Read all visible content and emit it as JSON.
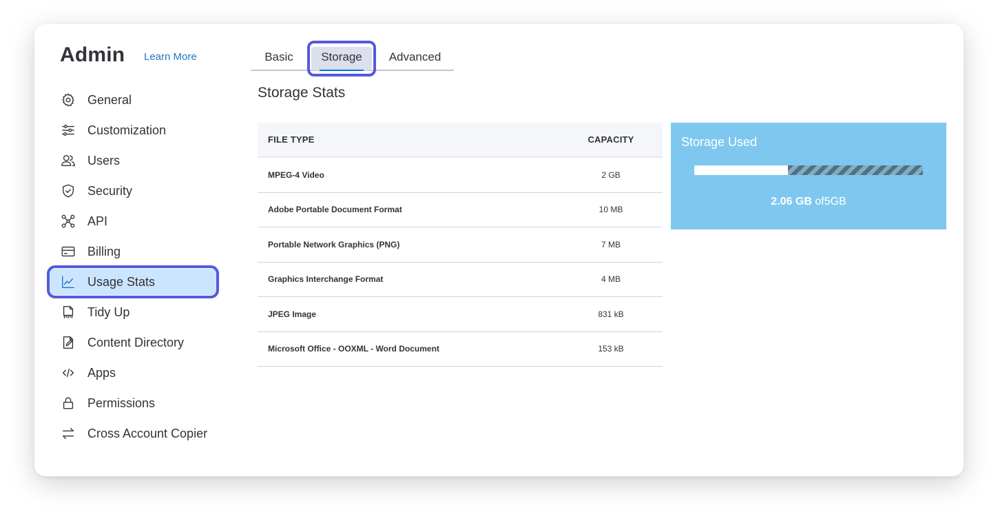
{
  "sidebar": {
    "title": "Admin",
    "learn_more": "Learn More",
    "items": [
      {
        "label": "General",
        "icon": "gear-icon"
      },
      {
        "label": "Customization",
        "icon": "sliders-icon"
      },
      {
        "label": "Users",
        "icon": "users-icon"
      },
      {
        "label": "Security",
        "icon": "shield-icon"
      },
      {
        "label": "API",
        "icon": "api-nodes-icon"
      },
      {
        "label": "Billing",
        "icon": "credit-card-icon"
      },
      {
        "label": "Usage Stats",
        "icon": "line-chart-icon",
        "active": true
      },
      {
        "label": "Tidy Up",
        "icon": "tidy-up-icon"
      },
      {
        "label": "Content Directory",
        "icon": "content-directory-icon"
      },
      {
        "label": "Apps",
        "icon": "code-icon"
      },
      {
        "label": "Permissions",
        "icon": "lock-icon"
      },
      {
        "label": "Cross Account Copier",
        "icon": "transfer-arrows-icon"
      }
    ]
  },
  "tabs": [
    {
      "label": "Basic"
    },
    {
      "label": "Storage",
      "active": true
    },
    {
      "label": "Advanced"
    }
  ],
  "main": {
    "section_title": "Storage Stats",
    "table": {
      "headers": [
        "FILE TYPE",
        "CAPACITY"
      ],
      "rows": [
        {
          "type": "MPEG-4 Video",
          "capacity": "2 GB"
        },
        {
          "type": "Adobe Portable Document Format",
          "capacity": "10 MB"
        },
        {
          "type": "Portable Network Graphics (PNG)",
          "capacity": "7 MB"
        },
        {
          "type": "Graphics Interchange Format",
          "capacity": "4 MB"
        },
        {
          "type": "JPEG Image",
          "capacity": "831 kB"
        },
        {
          "type": "Microsoft Office - OOXML - Word Document",
          "capacity": "153 kB"
        }
      ]
    }
  },
  "storage_panel": {
    "title": "Storage Used",
    "used": "2.06 GB",
    "of_label": "of",
    "total": "5GB",
    "used_fraction": 0.41
  },
  "colors": {
    "highlight_outline": "#5559df",
    "active_item_bg": "#cce5ff",
    "storage_panel_bg": "#7ec8ef",
    "link": "#1f76c2"
  }
}
